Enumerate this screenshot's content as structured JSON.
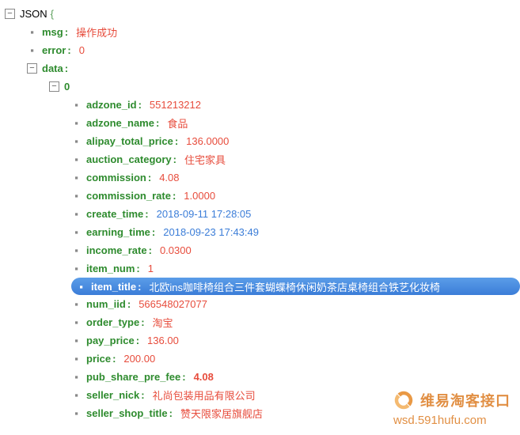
{
  "root": "JSON",
  "msg": {
    "k": "msg",
    "v": "操作成功"
  },
  "error": {
    "k": "error",
    "v": "0"
  },
  "dataK": "data",
  "idx": "0",
  "f": [
    {
      "k": "adzone_id",
      "v": "551213212",
      "t": "red"
    },
    {
      "k": "adzone_name",
      "v": "食品",
      "t": "red"
    },
    {
      "k": "alipay_total_price",
      "v": "136.0000",
      "t": "red"
    },
    {
      "k": "auction_category",
      "v": "住宅家具",
      "t": "red"
    },
    {
      "k": "commission",
      "v": "4.08",
      "t": "red"
    },
    {
      "k": "commission_rate",
      "v": "1.0000",
      "t": "red"
    },
    {
      "k": "create_time",
      "v": "2018-09-11 17:28:05",
      "t": "blue"
    },
    {
      "k": "earning_time",
      "v": "2018-09-23 17:43:49",
      "t": "blue"
    },
    {
      "k": "income_rate",
      "v": "0.0300",
      "t": "red"
    },
    {
      "k": "item_num",
      "v": "1",
      "t": "red"
    },
    {
      "k": "item_title",
      "v": "北欧ins咖啡椅组合三件套蝴蝶椅休闲奶茶店桌椅组合铁艺化妆椅",
      "t": "hl"
    },
    {
      "k": "num_iid",
      "v": "566548027077",
      "t": "red"
    },
    {
      "k": "order_type",
      "v": "淘宝",
      "t": "red"
    },
    {
      "k": "pay_price",
      "v": "136.00",
      "t": "red"
    },
    {
      "k": "price",
      "v": "200.00",
      "t": "red"
    },
    {
      "k": "pub_share_pre_fee",
      "v": "4.08",
      "t": "redb"
    },
    {
      "k": "seller_nick",
      "v": "礼尚包装用品有限公司",
      "t": "red"
    },
    {
      "k": "seller_shop_title",
      "v": "赞天限家居旗舰店",
      "t": "red"
    }
  ],
  "wm": {
    "title": "维易淘客接口",
    "url": "wsd.591hufu.com"
  }
}
